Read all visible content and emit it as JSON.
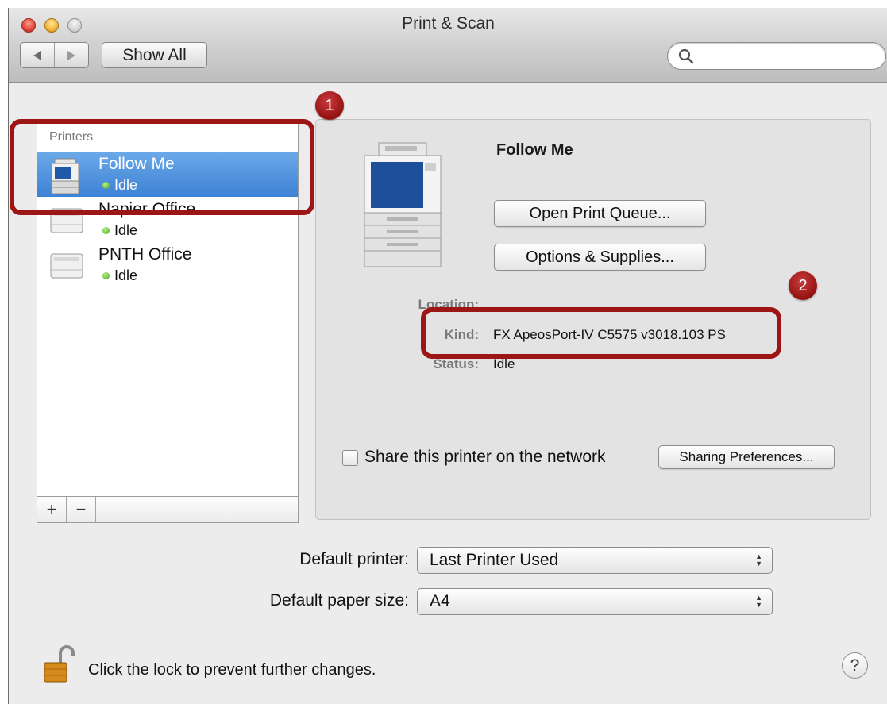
{
  "window": {
    "title": "Print & Scan"
  },
  "toolbar": {
    "show_all_label": "Show All",
    "search": {
      "placeholder": "",
      "icon": "search-icon"
    }
  },
  "sidebar": {
    "header": "Printers",
    "printers": [
      {
        "name": "Follow Me",
        "status": "Idle",
        "selected": true,
        "icon": "multifunction-printer-icon"
      },
      {
        "name": "Napier Office",
        "status": "Idle",
        "selected": false,
        "icon": "printer-icon"
      },
      {
        "name": "PNTH Office",
        "status": "Idle",
        "selected": false,
        "icon": "printer-icon"
      }
    ],
    "add_label": "+",
    "remove_label": "−"
  },
  "detail": {
    "printer_name": "Follow Me",
    "open_queue_label": "Open Print Queue...",
    "options_label": "Options & Supplies...",
    "location_label": "Location:",
    "location_value": "",
    "kind_label": "Kind:",
    "kind_value": "FX ApeosPort-IV C5575 v3018.103 PS",
    "status_label": "Status:",
    "status_value": "Idle",
    "share_label": "Share this printer on the network",
    "share_checked": false,
    "sharing_prefs_label": "Sharing Preferences..."
  },
  "defaults": {
    "printer_label": "Default printer:",
    "printer_value": "Last Printer Used",
    "paper_label": "Default paper size:",
    "paper_value": "A4"
  },
  "footer": {
    "lock_text": "Click the lock to prevent further changes.",
    "help_label": "?"
  },
  "annotations": [
    {
      "number": "1"
    },
    {
      "number": "2"
    }
  ],
  "colors": {
    "selection": "#3d82d5",
    "annotation": "#9e1515",
    "status_dot": "#48a51c"
  }
}
